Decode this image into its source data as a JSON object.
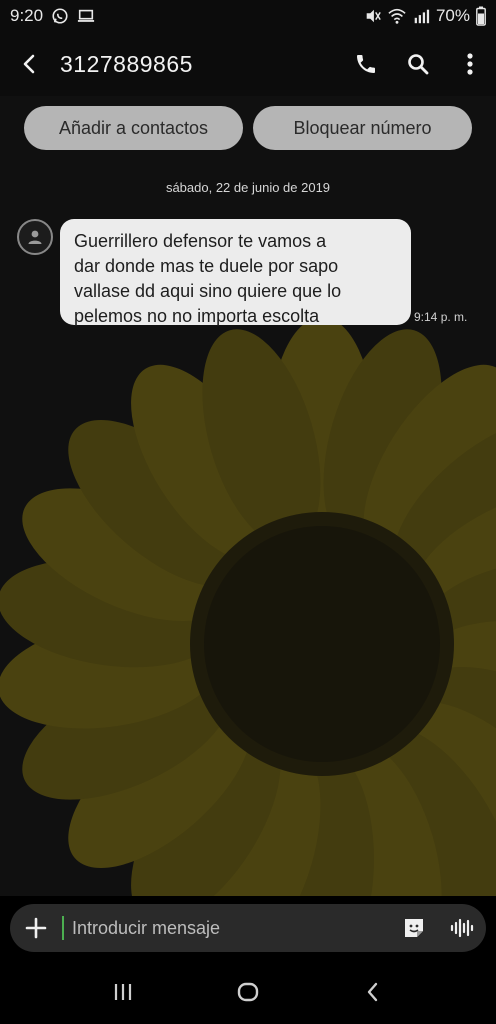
{
  "status_bar": {
    "time": "9:20",
    "battery": "70%",
    "left_icons": [
      "whatsapp-icon",
      "laptop-icon"
    ],
    "right_icons": [
      "mute-icon",
      "wifi-icon",
      "signal-icon"
    ]
  },
  "header": {
    "contact_number": "3127889865",
    "icons": [
      "back-arrow-icon",
      "phone-icon",
      "search-icon",
      "more-vertical-icon"
    ]
  },
  "actions": {
    "add_contact_label": "Añadir a contactos",
    "block_number_label": "Bloquear número"
  },
  "conversation": {
    "date_label": "sábado, 22 de junio de 2019",
    "messages": [
      {
        "text": "Guerrillero defensor te vamos a\ndar donde mas te duele por sapo\nvallase dd aqui sino quiere que lo\npelemos no no importa escolta",
        "time": "9:14 p. m."
      }
    ]
  },
  "compose": {
    "placeholder": "Introducir mensaje",
    "icons": [
      "plus-icon",
      "sticker-icon",
      "voice-icon"
    ]
  },
  "nav": {
    "icons": [
      "recent-apps-icon",
      "home-icon",
      "back-icon"
    ]
  },
  "colors": {
    "background": "#0c0c0c",
    "bubble": "#ececec",
    "pill": "#b5b5b5",
    "cursor": "#4caf50",
    "sunflower_petal": "#4a4210",
    "sunflower_center": "#1e1b0b"
  }
}
